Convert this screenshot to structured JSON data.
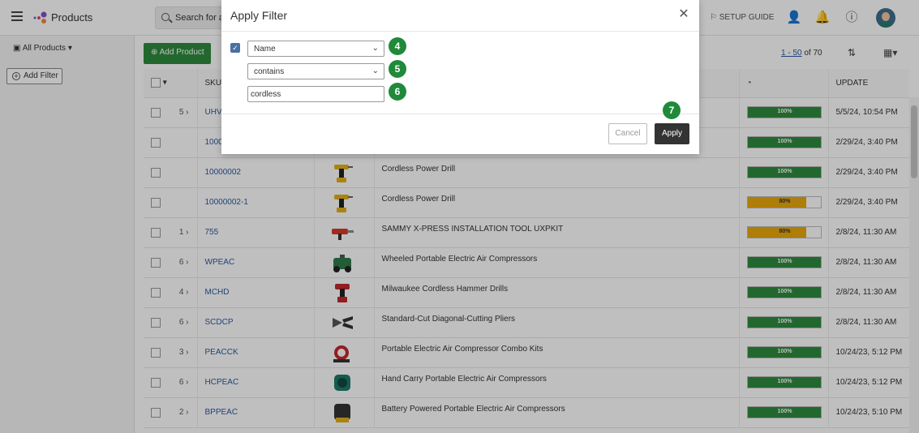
{
  "header": {
    "app_title": "Products",
    "search_placeholder": "Search for a",
    "setup_guide": "SETUP GUIDE"
  },
  "sidebar": {
    "all_products": "All Products ▾",
    "add_filter": "Add Filter"
  },
  "toolbar": {
    "add_product": "Add Product",
    "pager_range": "1 - 50",
    "pager_of": " of 70"
  },
  "table": {
    "headers": {
      "sku": "SKU",
      "update": "UPDATE"
    },
    "rows": [
      {
        "count": "5",
        "sku": "UHV",
        "name": "",
        "thumb": "blank",
        "progress": 100,
        "progress_label": "100%",
        "update": "5/5/24, 10:54 PM"
      },
      {
        "count": "",
        "sku": "1000",
        "name": "",
        "thumb": "drill-edge",
        "progress": 100,
        "progress_label": "100%",
        "update": "2/29/24, 3:40 PM"
      },
      {
        "count": "",
        "sku": "10000002",
        "name": "Cordless Power Drill",
        "thumb": "drill",
        "progress": 100,
        "progress_label": "100%",
        "update": "2/29/24, 3:40 PM"
      },
      {
        "count": "",
        "sku": "10000002-1",
        "name": "Cordless Power Drill",
        "thumb": "drill",
        "progress": 80,
        "progress_label": "80%",
        "update": "2/29/24, 3:40 PM"
      },
      {
        "count": "1",
        "sku": "755",
        "name": "SAMMY X-PRESS INSTALLATION TOOL UXPKIT",
        "thumb": "tool-red",
        "progress": 80,
        "progress_label": "80%",
        "update": "2/8/24, 11:30 AM"
      },
      {
        "count": "6",
        "sku": "WPEAC",
        "name": "Wheeled Portable Electric Air Compressors",
        "thumb": "compressor-green",
        "progress": 100,
        "progress_label": "100%",
        "update": "2/8/24, 11:30 AM"
      },
      {
        "count": "4",
        "sku": "MCHD",
        "name": "Milwaukee Cordless Hammer Drills",
        "thumb": "drill-red",
        "progress": 100,
        "progress_label": "100%",
        "update": "2/8/24, 11:30 AM"
      },
      {
        "count": "6",
        "sku": "SCDCP",
        "name": "Standard-Cut Diagonal-Cutting Pliers",
        "thumb": "pliers",
        "progress": 100,
        "progress_label": "100%",
        "update": "2/8/24, 11:30 AM"
      },
      {
        "count": "3",
        "sku": "PEACCK",
        "name": "Portable Electric Air Compressor Combo Kits",
        "thumb": "compressor-red",
        "progress": 100,
        "progress_label": "100%",
        "update": "10/24/23, 5:12 PM"
      },
      {
        "count": "6",
        "sku": "HCPEAC",
        "name": "Hand Carry Portable Electric Air Compressors",
        "thumb": "compressor-teal",
        "progress": 100,
        "progress_label": "100%",
        "update": "10/24/23, 5:12 PM"
      },
      {
        "count": "2",
        "sku": "BPPEAC",
        "name": "Battery Powered Portable Electric Air Compressors",
        "thumb": "compressor-yellow",
        "progress": 100,
        "progress_label": "100%",
        "update": "10/24/23, 5:10 PM"
      }
    ]
  },
  "modal": {
    "title": "Apply Filter",
    "field_select": "Name",
    "operator_select": "contains",
    "value_input": "cordless",
    "cancel": "Cancel",
    "apply": "Apply",
    "steps": [
      "4",
      "5",
      "6",
      "7"
    ]
  },
  "colors": {
    "progress_full": "#2e8b3e",
    "progress_partial": "#e8a90c",
    "accent_green": "#1f8a3a",
    "link_blue": "#2a5aa0"
  }
}
